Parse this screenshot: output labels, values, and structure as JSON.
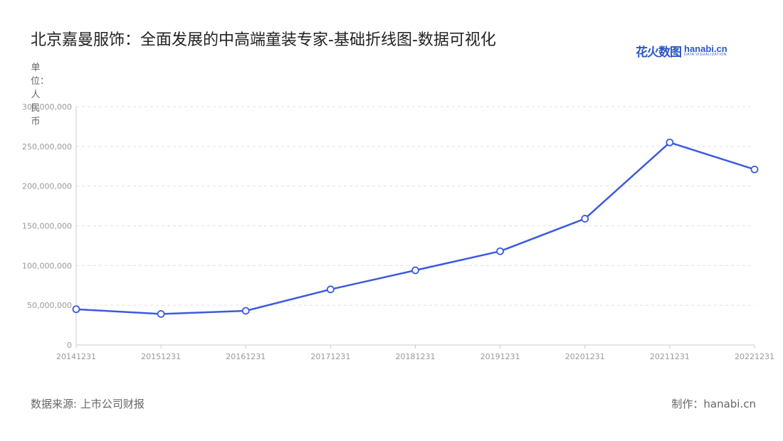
{
  "title": "北京嘉曼服饰：全面发展的中高端童装专家-基础折线图-数据可视化",
  "logo": {
    "cn": "花火数图",
    "en": "hanabi.cn",
    "tagline": "DATA VISUALIZATION"
  },
  "unit_label": "单位：人民币",
  "footer": {
    "source": "数据来源: 上市公司财报",
    "maker": "制作：hanabi.cn"
  },
  "colors": {
    "line": "#3d5ae0",
    "grid": "#e0e0e0",
    "axis_text": "#999999"
  },
  "chart_data": {
    "type": "line",
    "x": [
      "20141231",
      "20151231",
      "20161231",
      "20171231",
      "20181231",
      "20191231",
      "20201231",
      "20211231",
      "20221231"
    ],
    "y": [
      45000000,
      39000000,
      43000000,
      70000000,
      94000000,
      118000000,
      159000000,
      255000000,
      221000000
    ],
    "ylim": [
      0,
      300000000
    ],
    "yticks": [
      0,
      50000000,
      100000000,
      150000000,
      200000000,
      250000000,
      300000000
    ],
    "ytick_labels": [
      "0",
      "50,000,000",
      "100,000,000",
      "150,000,000",
      "200,000,000",
      "250,000,000",
      "300,000,000"
    ],
    "grid": true,
    "legend": false
  }
}
